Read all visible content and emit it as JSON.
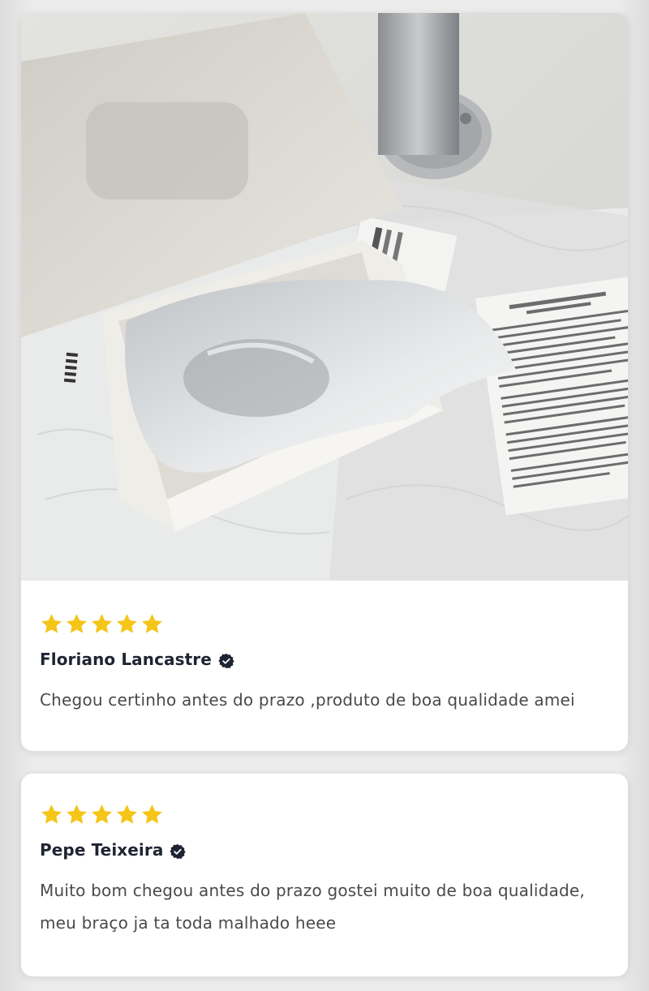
{
  "colors": {
    "star": "#f5c518",
    "author": "#1f2433",
    "text": "#4a4a4a",
    "verified": "#1f2433"
  },
  "reviews": [
    {
      "rating": 5,
      "author": "Floriano Lancastre",
      "verified_icon": "verified-badge-icon",
      "text": "Chegou certinho antes do prazo ,produto de boa qualidade amei",
      "has_photo": true
    },
    {
      "rating": 5,
      "author": "Pepe Teixeira",
      "verified_icon": "verified-badge-icon",
      "text": "Muito bom chegou antes do prazo gostei muito de boa qualidade, meu braço ja ta toda malhado heee",
      "has_photo": false
    }
  ]
}
